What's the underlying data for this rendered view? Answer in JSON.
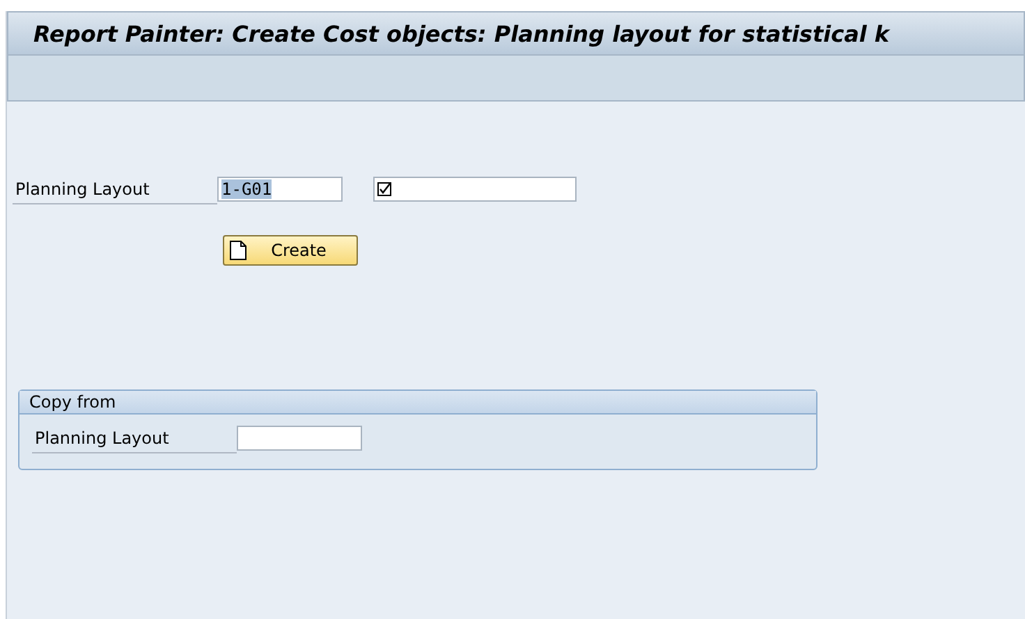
{
  "window": {
    "title": "Report Painter: Create Cost objects: Planning layout for statistical k"
  },
  "main_form": {
    "label": "Planning Layout",
    "value": "1-G01",
    "value_highlighted": true,
    "description_field": {
      "required": true
    }
  },
  "create_button": {
    "label": "Create"
  },
  "copy_from": {
    "title": "Copy from",
    "label": "Planning Layout"
  }
}
